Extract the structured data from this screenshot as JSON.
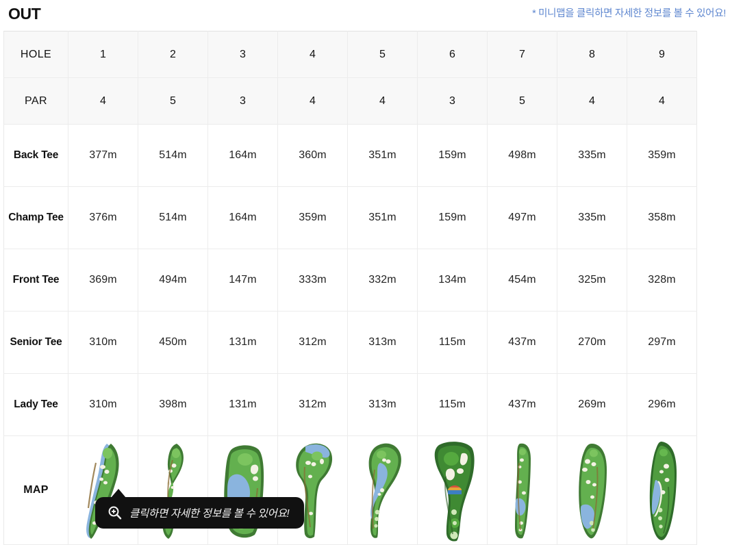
{
  "header": {
    "section_title": "OUT",
    "notice": "* 미니맵을 클릭하면 자세한 정보를 볼 수 있어요!",
    "notice_color": "#5d86cf"
  },
  "table": {
    "row_labels": {
      "hole": "HOLE",
      "par": "PAR",
      "back_tee": "Back Tee",
      "champ_tee": "Champ Tee",
      "front_tee": "Front Tee",
      "senior_tee": "Senior Tee",
      "lady_tee": "Lady Tee",
      "map": "MAP"
    },
    "holes": [
      "1",
      "2",
      "3",
      "4",
      "5",
      "6",
      "7",
      "8",
      "9"
    ],
    "par": [
      "4",
      "5",
      "3",
      "4",
      "4",
      "3",
      "5",
      "4",
      "4"
    ],
    "back_tee": [
      "377m",
      "514m",
      "164m",
      "360m",
      "351m",
      "159m",
      "498m",
      "335m",
      "359m"
    ],
    "champ_tee": [
      "376m",
      "514m",
      "164m",
      "359m",
      "351m",
      "159m",
      "497m",
      "335m",
      "358m"
    ],
    "front_tee": [
      "369m",
      "494m",
      "147m",
      "333m",
      "332m",
      "134m",
      "454m",
      "325m",
      "328m"
    ],
    "senior_tee": [
      "310m",
      "450m",
      "131m",
      "312m",
      "313m",
      "115m",
      "437m",
      "270m",
      "297m"
    ],
    "lady_tee": [
      "310m",
      "398m",
      "131m",
      "312m",
      "313m",
      "115m",
      "437m",
      "269m",
      "296m"
    ],
    "map_alt": [
      "hole-1-minimap",
      "hole-2-minimap",
      "hole-3-minimap",
      "hole-4-minimap",
      "hole-5-minimap",
      "hole-6-minimap",
      "hole-7-minimap",
      "hole-8-minimap",
      "hole-9-minimap"
    ]
  },
  "tooltip": {
    "icon": "magnifier-plus-icon",
    "text": "클릭하면 자세한 정보를 볼 수 있어요!",
    "background": "#111111"
  },
  "colors": {
    "header_row_bg": "#f8f8f8",
    "border": "#ececec",
    "fairway_green": "#5fae4e",
    "rough_green": "#2f6b2a",
    "water_blue": "#8ab4de",
    "sand": "#f2f0e2"
  }
}
